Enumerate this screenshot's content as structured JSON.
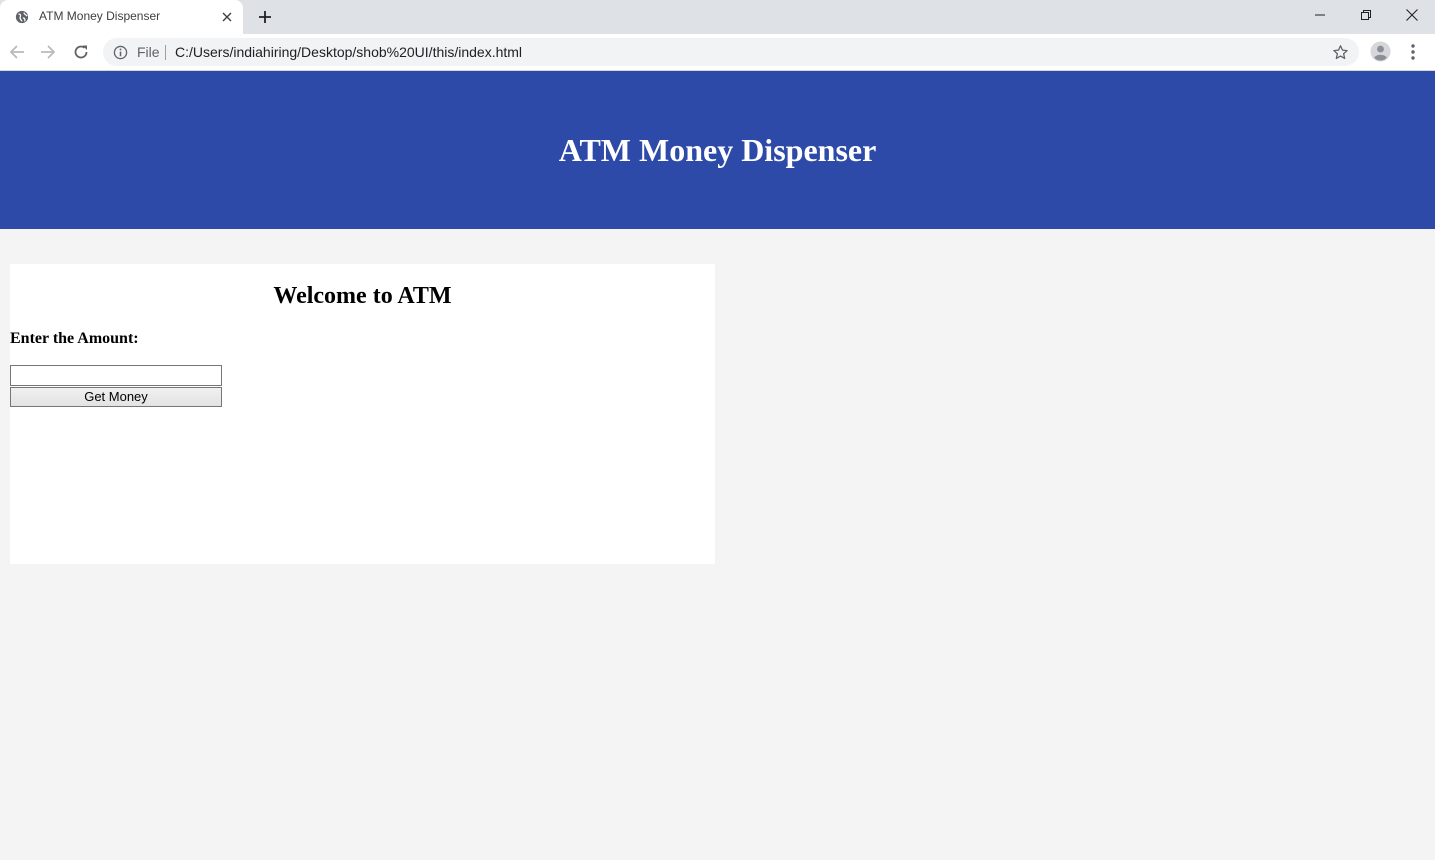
{
  "browser": {
    "tab_title": "ATM Money Dispenser",
    "scheme_label": "File",
    "url": "C:/Users/indiahiring/Desktop/shob%20UI/this/index.html",
    "icons": {
      "favicon": "globe-icon",
      "tab_close": "close-icon",
      "new_tab": "plus-icon",
      "back": "arrow-left-icon",
      "forward": "arrow-right-icon",
      "reload": "reload-icon",
      "info": "info-icon",
      "bookmark": "star-icon",
      "profile": "profile-icon",
      "menu": "kebab-menu-icon",
      "minimize": "minimize-icon",
      "maximize": "restore-icon",
      "close": "close-icon"
    }
  },
  "header": {
    "title": "ATM Money Dispenser",
    "background": "#2d4aa8",
    "text_color": "#ffffff"
  },
  "atm": {
    "welcome": "Welcome to ATM",
    "amount_label": "Enter the Amount:",
    "amount_value": "",
    "button_label": "Get Money"
  },
  "colors": {
    "page_background": "#f4f4f4",
    "panel_background": "#ffffff",
    "tabbar_background": "#dee1e6"
  }
}
